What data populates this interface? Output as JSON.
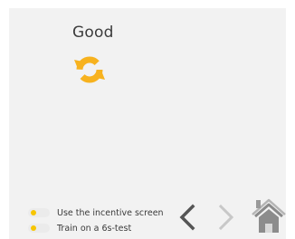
{
  "main": {
    "title": "Good",
    "status_icon": "refresh-icon"
  },
  "options": [
    {
      "label": "Use the incentive screen",
      "icon": "toggle-switch"
    },
    {
      "label": "Train on a 6s-test",
      "icon": "toggle-switch"
    }
  ],
  "navigation": {
    "back_icon": "chevron-left-icon",
    "forward_icon": "chevron-right-icon",
    "home_icon": "home-icon"
  },
  "colors": {
    "panel_background": "#f2f2f2",
    "accent": "#f7b21e",
    "accent_light": "#fcd25c",
    "text": "#3c3c3c",
    "chevron_active": "#555555",
    "chevron_disabled": "#c8c8c8",
    "home_grey": "#8a8a8a"
  }
}
